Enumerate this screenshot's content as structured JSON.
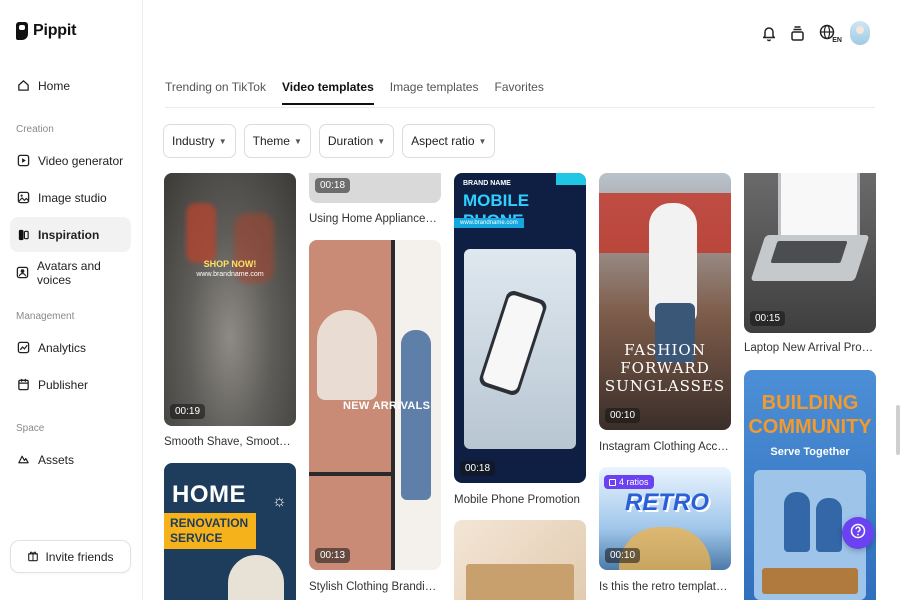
{
  "app": {
    "name": "Pippit"
  },
  "sidebar": {
    "top_items": [
      {
        "label": "Home",
        "icon": "home-icon"
      }
    ],
    "sections": [
      {
        "label": "Creation",
        "items": [
          {
            "label": "Video generator",
            "icon": "video-icon"
          },
          {
            "label": "Image studio",
            "icon": "image-icon"
          },
          {
            "label": "Inspiration",
            "icon": "inspiration-icon",
            "active": true
          },
          {
            "label": "Avatars and voices",
            "icon": "avatar-voice-icon"
          }
        ]
      },
      {
        "label": "Management",
        "items": [
          {
            "label": "Analytics",
            "icon": "analytics-icon"
          },
          {
            "label": "Publisher",
            "icon": "calendar-icon"
          }
        ]
      },
      {
        "label": "Space",
        "items": [
          {
            "label": "Assets",
            "icon": "cloud-icon"
          }
        ]
      }
    ],
    "invite_label": "Invite friends"
  },
  "topbar": {
    "language": "EN"
  },
  "tabs": [
    "Trending on TikTok",
    "Video templates",
    "Image templates",
    "Favorites"
  ],
  "active_tab": "Video templates",
  "filters": [
    "Industry",
    "Theme",
    "Duration",
    "Aspect ratio"
  ],
  "cards": {
    "shave": {
      "duration": "00:19",
      "caption": "Smooth Shave, Smooth Life!",
      "overlay_line1": "SHOP NOW!",
      "overlay_line2": "www.brandname.com"
    },
    "home_reno": {
      "title": "HOME",
      "subtitle": "RENOVATION SERVICE"
    },
    "appliances": {
      "duration": "00:18",
      "caption": "Using Home Appliances in Mi..."
    },
    "clothing": {
      "duration": "00:13",
      "caption": "Stylish Clothing Branding Te...",
      "overlay": "NEW ARRIVALS"
    },
    "phone": {
      "duration": "00:18",
      "caption": "Mobile Phone Promotion",
      "brand": "BRAND NAME",
      "title": "MOBILE PHONE",
      "url": "www.brandname.com"
    },
    "sunglasses": {
      "duration": "00:10",
      "caption": "Instagram Clothing Accecorie...",
      "line1": "FASHION",
      "line2": "FORWARD",
      "line3": "SUNGLASSES"
    },
    "retro": {
      "duration": "00:10",
      "caption": "Is this the retro template you ...",
      "ratios": "4 ratios",
      "title": "RETRO"
    },
    "laptop": {
      "duration": "00:15",
      "caption": "Laptop New Arrival Promotion"
    },
    "community": {
      "line1": "BUILDING",
      "line2": "COMMUNITY",
      "line3": "Serve Together"
    }
  },
  "colors": {
    "accent": "#6a42f1",
    "phone_blue": "#14a7e0",
    "community_orange": "#f39a2c"
  }
}
